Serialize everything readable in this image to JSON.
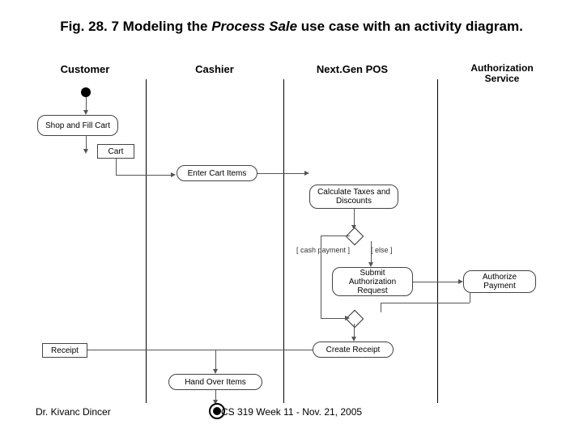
{
  "title": {
    "prefix": "Fig. 28. 7 Modeling the ",
    "italic": "Process Sale",
    "suffix": " use case with an activity diagram."
  },
  "lanes": {
    "customer": "Customer",
    "cashier": "Cashier",
    "pos": "Next.Gen POS",
    "auth": "Authorization Service"
  },
  "nodes": {
    "shopFill": "Shop and Fill Cart",
    "cart": "Cart",
    "enterCart": "Enter Cart Items",
    "calc": "Calculate Taxes and Discounts",
    "guardCash": "[ cash payment ]",
    "guardElse": "[ else ]",
    "submitAuth": "Submit Authorization Request",
    "authorize": "Authorize Payment",
    "createReceipt": "Create Receipt",
    "receipt": "Receipt",
    "handOver": "Hand Over Items"
  },
  "footer": {
    "author": "Dr. Kivanc Dincer",
    "course": "CS 319 Week 11 - Nov. 21, 2005"
  }
}
